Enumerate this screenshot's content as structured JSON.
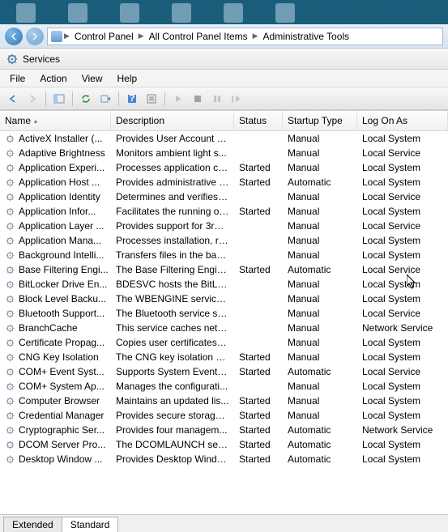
{
  "breadcrumb": {
    "items": [
      "Control Panel",
      "All Control Panel Items",
      "Administrative Tools"
    ]
  },
  "window": {
    "title": "Services"
  },
  "menu": {
    "file": "File",
    "action": "Action",
    "view": "View",
    "help": "Help"
  },
  "columns": {
    "name": "Name",
    "description": "Description",
    "status": "Status",
    "startup": "Startup Type",
    "logon": "Log On As"
  },
  "tabs": {
    "extended": "Extended",
    "standard": "Standard"
  },
  "services": [
    {
      "name": "ActiveX Installer (...",
      "desc": "Provides User Account C...",
      "status": "",
      "startup": "Manual",
      "logon": "Local System"
    },
    {
      "name": "Adaptive Brightness",
      "desc": "Monitors ambient light s...",
      "status": "",
      "startup": "Manual",
      "logon": "Local Service"
    },
    {
      "name": "Application Experi...",
      "desc": "Processes application co...",
      "status": "Started",
      "startup": "Manual",
      "logon": "Local System"
    },
    {
      "name": "Application Host ...",
      "desc": "Provides administrative s...",
      "status": "Started",
      "startup": "Automatic",
      "logon": "Local System"
    },
    {
      "name": "Application Identity",
      "desc": "Determines and verifies t...",
      "status": "",
      "startup": "Manual",
      "logon": "Local Service"
    },
    {
      "name": "Application Infor...",
      "desc": "Facilitates the running of...",
      "status": "Started",
      "startup": "Manual",
      "logon": "Local System"
    },
    {
      "name": "Application Layer ...",
      "desc": "Provides support for 3rd ...",
      "status": "",
      "startup": "Manual",
      "logon": "Local Service"
    },
    {
      "name": "Application Mana...",
      "desc": "Processes installation, re...",
      "status": "",
      "startup": "Manual",
      "logon": "Local System"
    },
    {
      "name": "Background Intelli...",
      "desc": "Transfers files in the bac...",
      "status": "",
      "startup": "Manual",
      "logon": "Local System"
    },
    {
      "name": "Base Filtering Engi...",
      "desc": "The Base Filtering Engine...",
      "status": "Started",
      "startup": "Automatic",
      "logon": "Local Service"
    },
    {
      "name": "BitLocker Drive En...",
      "desc": "BDESVC hosts the BitLoc...",
      "status": "",
      "startup": "Manual",
      "logon": "Local System"
    },
    {
      "name": "Block Level Backu...",
      "desc": "The WBENGINE service is...",
      "status": "",
      "startup": "Manual",
      "logon": "Local System"
    },
    {
      "name": "Bluetooth Support...",
      "desc": "The Bluetooth service su...",
      "status": "",
      "startup": "Manual",
      "logon": "Local Service"
    },
    {
      "name": "BranchCache",
      "desc": "This service caches netw...",
      "status": "",
      "startup": "Manual",
      "logon": "Network Service"
    },
    {
      "name": "Certificate Propag...",
      "desc": "Copies user certificates a...",
      "status": "",
      "startup": "Manual",
      "logon": "Local System"
    },
    {
      "name": "CNG Key Isolation",
      "desc": "The CNG key isolation se...",
      "status": "Started",
      "startup": "Manual",
      "logon": "Local System"
    },
    {
      "name": "COM+ Event Syst...",
      "desc": "Supports System Event N...",
      "status": "Started",
      "startup": "Automatic",
      "logon": "Local Service"
    },
    {
      "name": "COM+ System Ap...",
      "desc": "Manages the configurati...",
      "status": "",
      "startup": "Manual",
      "logon": "Local System"
    },
    {
      "name": "Computer Browser",
      "desc": "Maintains an updated lis...",
      "status": "Started",
      "startup": "Manual",
      "logon": "Local System"
    },
    {
      "name": "Credential Manager",
      "desc": "Provides secure storage ...",
      "status": "Started",
      "startup": "Manual",
      "logon": "Local System"
    },
    {
      "name": "Cryptographic Ser...",
      "desc": "Provides four managem...",
      "status": "Started",
      "startup": "Automatic",
      "logon": "Network Service"
    },
    {
      "name": "DCOM Server Pro...",
      "desc": "The DCOMLAUNCH serv...",
      "status": "Started",
      "startup": "Automatic",
      "logon": "Local System"
    },
    {
      "name": "Desktop Window ...",
      "desc": "Provides Desktop Windo...",
      "status": "Started",
      "startup": "Automatic",
      "logon": "Local System"
    }
  ]
}
